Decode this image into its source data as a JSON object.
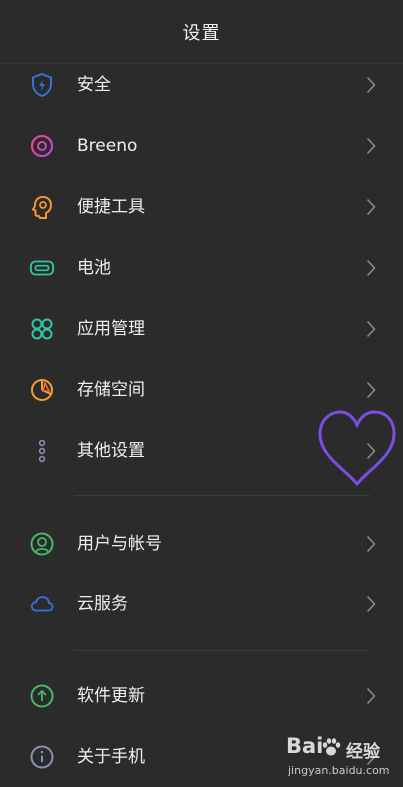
{
  "header": {
    "title": "设置"
  },
  "items": [
    {
      "label": "安全",
      "icon": "shield-icon",
      "color": "#3b6fd8"
    },
    {
      "label": "Breeno",
      "icon": "breeno-icon",
      "color": "#d94a8c"
    },
    {
      "label": "便捷工具",
      "icon": "tools-icon",
      "color": "#f29a2e"
    },
    {
      "label": "电池",
      "icon": "battery-icon",
      "color": "#2cc7a4"
    },
    {
      "label": "应用管理",
      "icon": "apps-icon",
      "color": "#2cc7a4"
    },
    {
      "label": "存储空间",
      "icon": "storage-icon",
      "color": "#f0a22c"
    },
    {
      "label": "其他设置",
      "icon": "more-settings-icon",
      "color": "#8a8fb8"
    },
    {
      "label": "用户与帐号",
      "icon": "user-icon",
      "color": "#47b86a"
    },
    {
      "label": "云服务",
      "icon": "cloud-icon",
      "color": "#3b6fd8"
    },
    {
      "label": "软件更新",
      "icon": "update-icon",
      "color": "#47b86a"
    },
    {
      "label": "关于手机",
      "icon": "info-icon",
      "color": "#8a8fb8"
    }
  ],
  "decoration": {
    "heart_color": "#7a4fe0"
  },
  "watermark": {
    "brand": "Bai",
    "brand2": "经验",
    "url": "jingyan.baidu.com"
  }
}
